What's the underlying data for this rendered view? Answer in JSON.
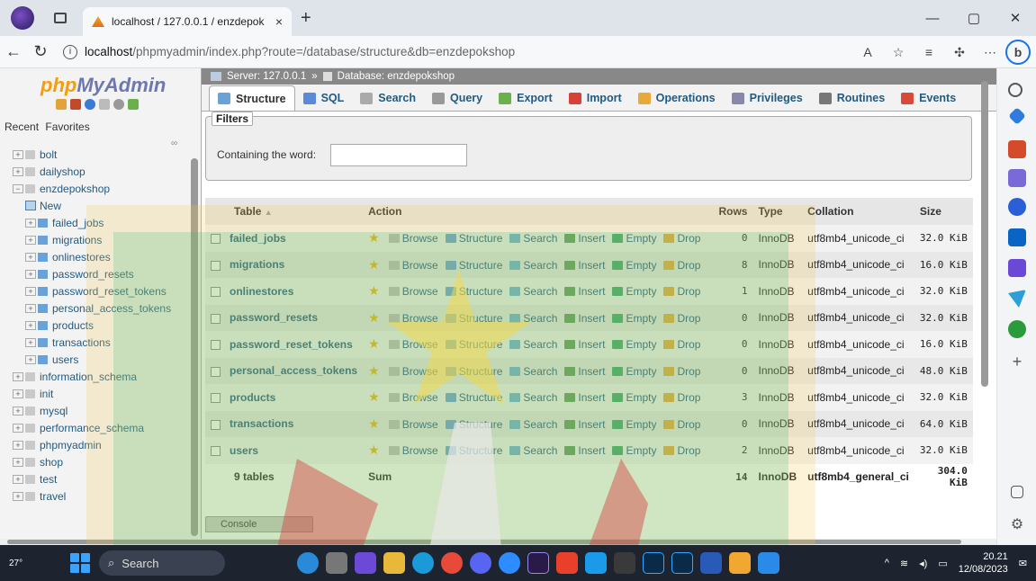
{
  "browser": {
    "tab_title": "localhost / 127.0.0.1 / enzdepok",
    "url_host": "localhost",
    "url_path": "/phpmyadmin/index.php?route=/database/structure&db=enzdepokshop"
  },
  "pma": {
    "logo_php": "php",
    "logo_myadmin": "MyAdmin",
    "recent": "Recent",
    "favorites": "Favorites",
    "tree": [
      {
        "label": "bolt",
        "type": "db"
      },
      {
        "label": "dailyshop",
        "type": "db"
      },
      {
        "label": "enzdepokshop",
        "type": "db-open"
      },
      {
        "label": "New",
        "type": "new"
      },
      {
        "label": "failed_jobs",
        "type": "table"
      },
      {
        "label": "migrations",
        "type": "table"
      },
      {
        "label": "onlinestores",
        "type": "table"
      },
      {
        "label": "password_resets",
        "type": "table"
      },
      {
        "label": "password_reset_tokens",
        "type": "table"
      },
      {
        "label": "personal_access_tokens",
        "type": "table"
      },
      {
        "label": "products",
        "type": "table"
      },
      {
        "label": "transactions",
        "type": "table"
      },
      {
        "label": "users",
        "type": "table"
      },
      {
        "label": "information_schema",
        "type": "db"
      },
      {
        "label": "init",
        "type": "db"
      },
      {
        "label": "mysql",
        "type": "db"
      },
      {
        "label": "performance_schema",
        "type": "db"
      },
      {
        "label": "phpmyadmin",
        "type": "db"
      },
      {
        "label": "shop",
        "type": "db"
      },
      {
        "label": "test",
        "type": "db"
      },
      {
        "label": "travel",
        "type": "db"
      }
    ]
  },
  "breadcrumb": {
    "server": "Server: 127.0.0.1",
    "sep": "»",
    "database": "Database: enzdepokshop"
  },
  "menu": [
    "Structure",
    "SQL",
    "Search",
    "Query",
    "Export",
    "Import",
    "Operations",
    "Privileges",
    "Routines",
    "Events"
  ],
  "filters": {
    "legend": "Filters",
    "label": "Containing the word:",
    "value": ""
  },
  "table": {
    "headers": {
      "table": "Table",
      "action": "Action",
      "rows": "Rows",
      "type": "Type",
      "collation": "Collation",
      "size": "Size"
    },
    "actions": [
      "Browse",
      "Structure",
      "Search",
      "Insert",
      "Empty",
      "Drop"
    ],
    "rows": [
      {
        "name": "failed_jobs",
        "rows": "0",
        "type": "InnoDB",
        "collation": "utf8mb4_unicode_ci",
        "size": "32.0 KiB"
      },
      {
        "name": "migrations",
        "rows": "8",
        "type": "InnoDB",
        "collation": "utf8mb4_unicode_ci",
        "size": "16.0 KiB"
      },
      {
        "name": "onlinestores",
        "rows": "1",
        "type": "InnoDB",
        "collation": "utf8mb4_unicode_ci",
        "size": "32.0 KiB"
      },
      {
        "name": "password_resets",
        "rows": "0",
        "type": "InnoDB",
        "collation": "utf8mb4_unicode_ci",
        "size": "32.0 KiB"
      },
      {
        "name": "password_reset_tokens",
        "rows": "0",
        "type": "InnoDB",
        "collation": "utf8mb4_unicode_ci",
        "size": "16.0 KiB"
      },
      {
        "name": "personal_access_tokens",
        "rows": "0",
        "type": "InnoDB",
        "collation": "utf8mb4_unicode_ci",
        "size": "48.0 KiB"
      },
      {
        "name": "products",
        "rows": "3",
        "type": "InnoDB",
        "collation": "utf8mb4_unicode_ci",
        "size": "32.0 KiB"
      },
      {
        "name": "transactions",
        "rows": "0",
        "type": "InnoDB",
        "collation": "utf8mb4_unicode_ci",
        "size": "64.0 KiB"
      },
      {
        "name": "users",
        "rows": "2",
        "type": "InnoDB",
        "collation": "utf8mb4_unicode_ci",
        "size": "32.0 KiB"
      }
    ],
    "summary": {
      "count": "9 tables",
      "label": "Sum",
      "rows": "14",
      "type": "InnoDB",
      "collation": "utf8mb4_general_ci",
      "size": "304.0 KiB"
    }
  },
  "console": "Console",
  "taskbar": {
    "temp": "27°",
    "search": "Search",
    "time": "20.21",
    "date": "12/08/2023"
  }
}
